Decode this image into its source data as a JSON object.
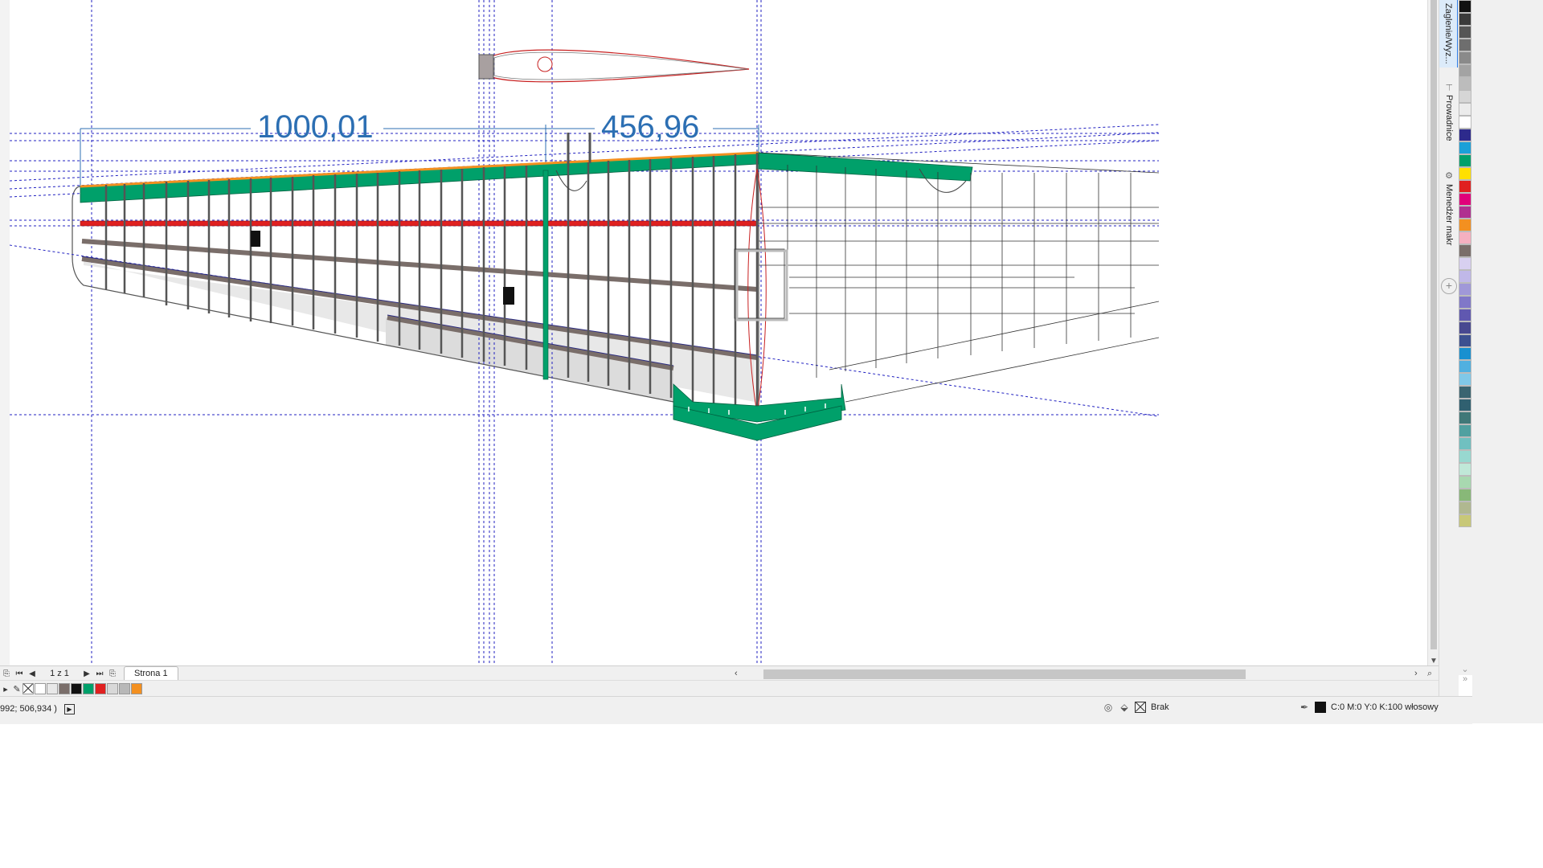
{
  "drawing": {
    "dimension_left": "1000,01",
    "dimension_right": "456,96"
  },
  "page_nav": {
    "counter": "1 z 1",
    "page_tab": "Strona 1"
  },
  "dockers": {
    "tab1": "Zaglenie/Wyz...",
    "tab2": "Prowadnice",
    "tab3": "Menedżer makr"
  },
  "status": {
    "coords": "992; 506,934 )",
    "fill_label": "Brak",
    "outline_label": "C:0 M:0 Y:0 K:100 włosowy"
  },
  "palette": [
    "#111111",
    "#3a3a3a",
    "#555555",
    "#6e6e6e",
    "#8a8a8a",
    "#a3a3a3",
    "#bcbcbc",
    "#d6d6d6",
    "#ececec",
    "#ffffff",
    "#2d2a8c",
    "#1aa0d8",
    "#00a06a",
    "#ffe000",
    "#e02020",
    "#e0007a",
    "#b03090",
    "#f39020",
    "#f5b0c0",
    "#7a6e6a",
    "#d8d0f0",
    "#c0b8e8",
    "#a098d8",
    "#8078c8",
    "#6058b0",
    "#484890",
    "#3c5090",
    "#1890d0",
    "#50b0e0",
    "#80c8e8",
    "#3a6470",
    "#306070",
    "#407878",
    "#50a0a0",
    "#70c0c0",
    "#98d8d0",
    "#c0e8d8",
    "#a8d8b0",
    "#88b878",
    "#b0b890",
    "#c8c878"
  ],
  "doc_palette": [
    "none",
    "#ffffff",
    "#e8e8e8",
    "#7a6e6a",
    "#111111",
    "#00a06a",
    "#e02020",
    "#d8d8d8",
    "#b8b8b8",
    "#f39020"
  ]
}
